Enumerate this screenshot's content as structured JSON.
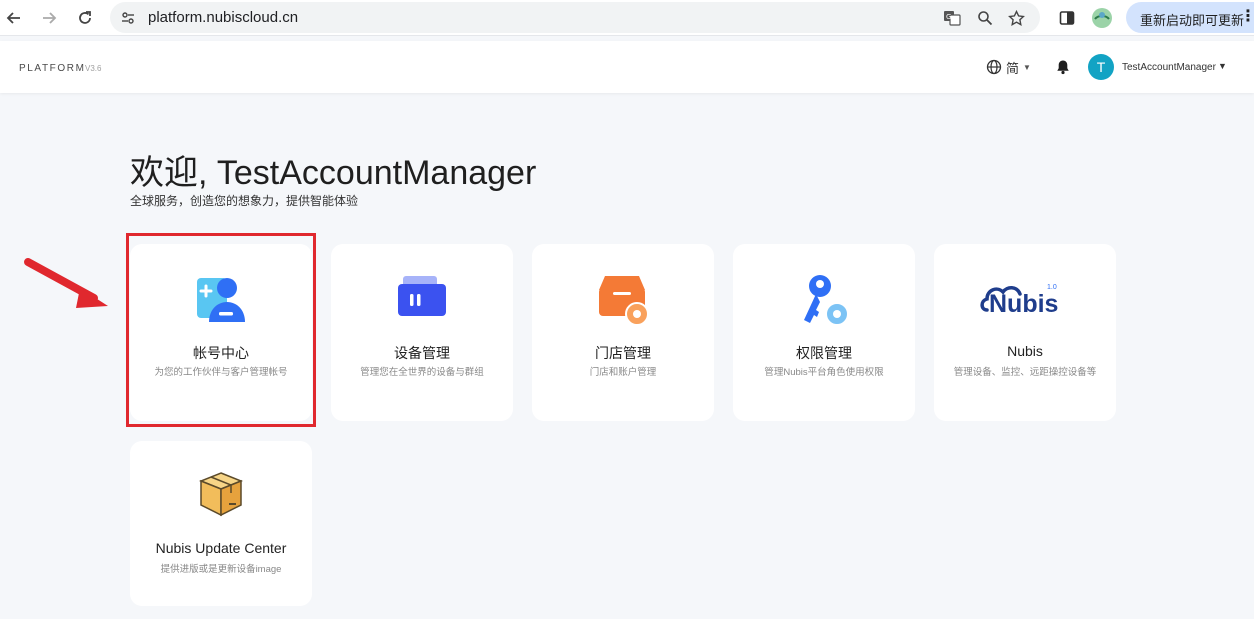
{
  "browser": {
    "url": "platform.nubiscloud.cn",
    "update_label": "重新启动即可更新",
    "more_label": "⋮"
  },
  "header": {
    "brand": "PLATFORM",
    "version": "V3.6",
    "language": "简",
    "avatar_initial": "T",
    "username": "TestAccountManager"
  },
  "welcome": {
    "title": "欢迎, TestAccountManager",
    "subtitle": "全球服务，创造您的想象力，提供智能体验"
  },
  "cards": [
    {
      "title": "帐号中心",
      "desc": "为您的工作伙伴与客户管理帐号",
      "icon": "account-center-icon"
    },
    {
      "title": "设备管理",
      "desc": "管理您在全世界的设备与群组",
      "icon": "device-management-icon"
    },
    {
      "title": "门店管理",
      "desc": "门店和账户管理",
      "icon": "store-management-icon"
    },
    {
      "title": "权限管理",
      "desc": "管理Nubis平台角色使用权限",
      "icon": "permission-key-icon"
    },
    {
      "title": "Nubis",
      "desc": "管理设备、监控、远距操控设备等",
      "icon": "nubis-logo-icon",
      "logo_text": "Nubis",
      "logo_sup": "1.0"
    },
    {
      "title": "Nubis Update Center",
      "desc": "提供进版或是更新设备image",
      "icon": "package-box-icon"
    }
  ],
  "colors": {
    "highlight": "#e0282e",
    "accent_blue": "#2f6ff5",
    "store_orange": "#f47a36",
    "avatar": "#12a3c4"
  }
}
